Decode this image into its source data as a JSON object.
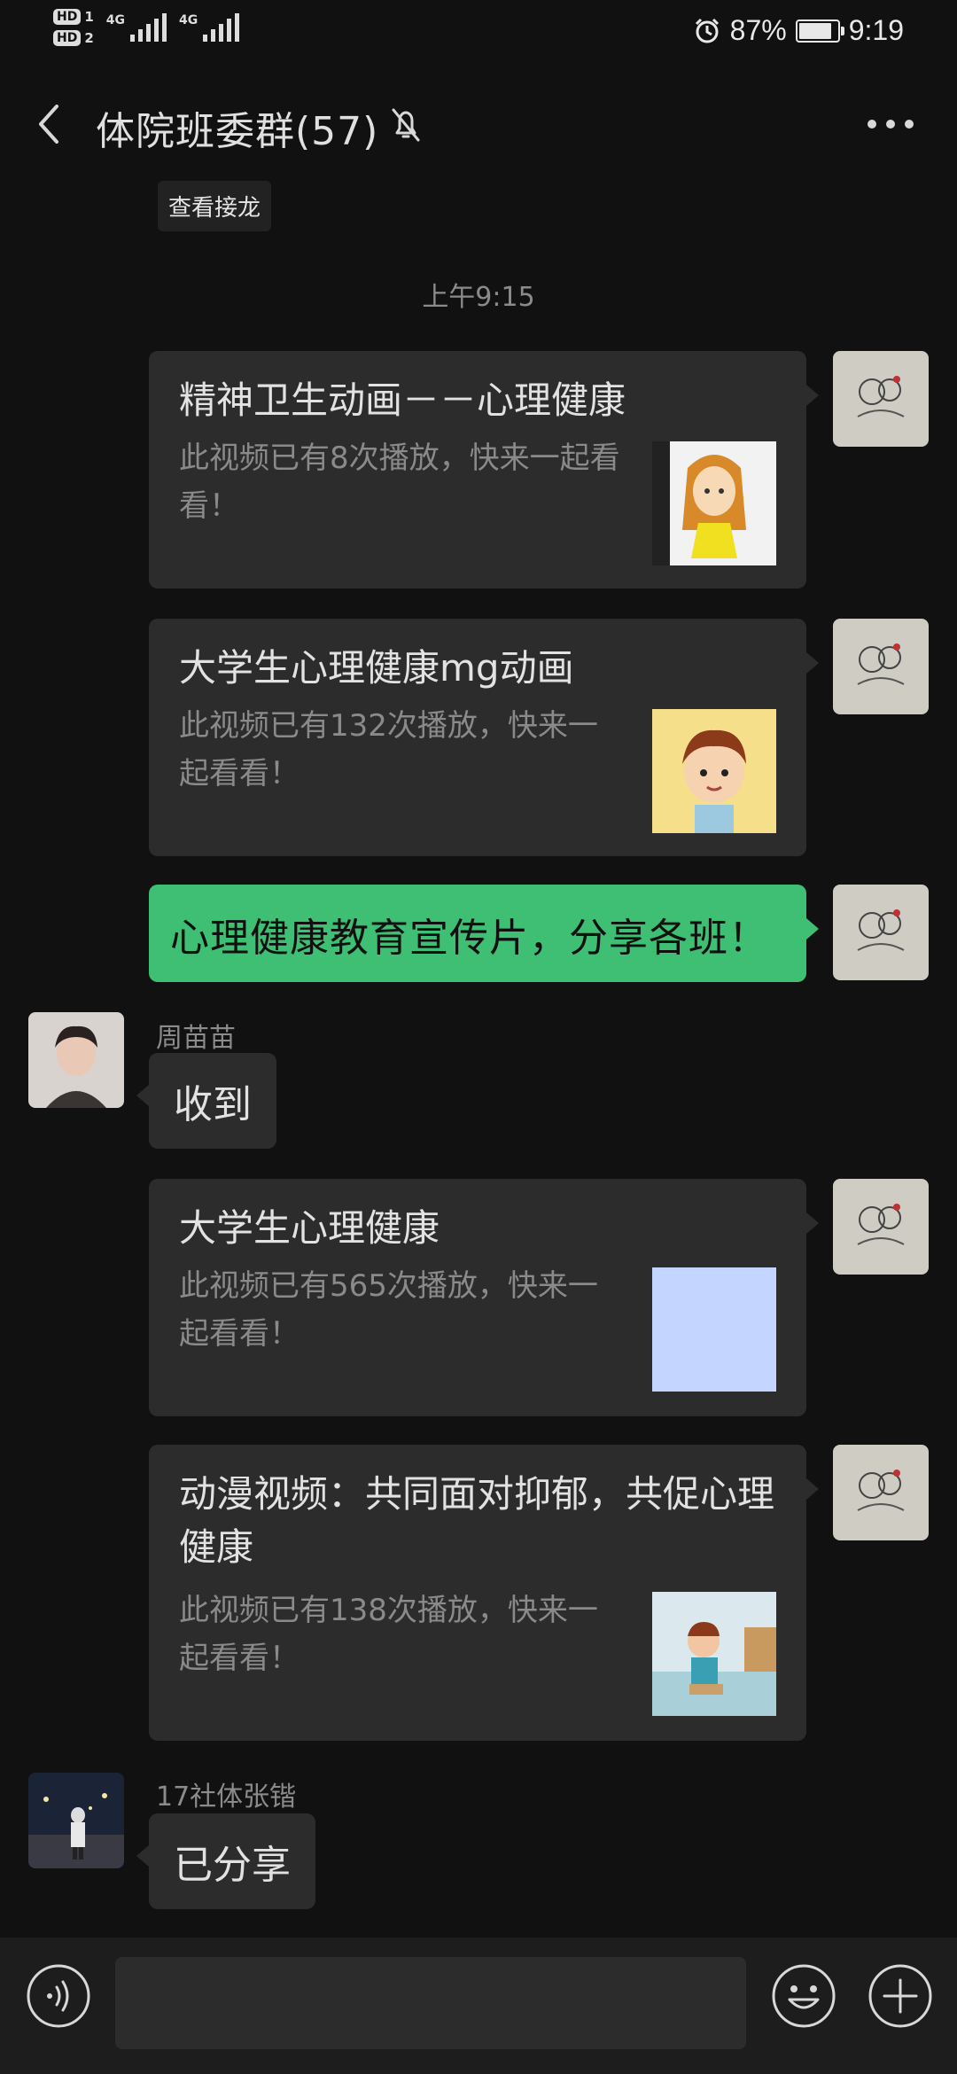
{
  "status_bar": {
    "hd1": "HD",
    "hd1_sub": "1",
    "hd2": "HD",
    "hd2_sub": "2",
    "net1": "4G",
    "net2": "4G",
    "battery_percent": "87%",
    "battery_level": 0.87,
    "time": "9:19"
  },
  "header": {
    "title": "体院班委群(57)"
  },
  "chat": {
    "jielong_label": "查看接龙",
    "timestamp": "上午9:15",
    "messages": [
      {
        "type": "video-card",
        "title": "精神卫生动画－－心理健康",
        "desc": "此视频已有8次播放，快来一起看看！"
      },
      {
        "type": "video-card",
        "title": "大学生心理健康mg动画",
        "desc": "此视频已有132次播放，快来一起看看！"
      },
      {
        "type": "text",
        "text": "心理健康教育宣传片，分享各班！"
      },
      {
        "type": "text-received",
        "sender": "周苗苗",
        "text": "收到"
      },
      {
        "type": "video-card",
        "title": "大学生心理健康",
        "desc": "此视频已有565次播放，快来一起看看！"
      },
      {
        "type": "video-card",
        "title": "动漫视频：共同面对抑郁，共促心理健康",
        "desc": "此视频已有138次播放，快来一起看看！"
      },
      {
        "type": "text-received",
        "sender": "17社体张锴",
        "text": "已分享"
      }
    ]
  },
  "colors": {
    "background": "#111111",
    "bubble_sent": "#3fbf73",
    "bubble_received": "#2c2c2c"
  },
  "icons": [
    "back-arrow-icon",
    "mute-bell-icon",
    "more-icon",
    "voice-icon",
    "emoji-icon",
    "plus-icon"
  ]
}
